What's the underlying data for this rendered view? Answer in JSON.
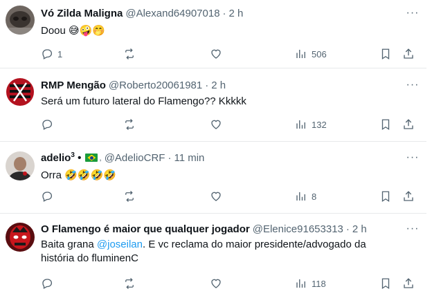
{
  "tweets": [
    {
      "name": "Vó Zilda Maligna",
      "handle": "@Alexand64907018",
      "time": "2 h",
      "text": "Doou 😅🤪🤭",
      "replies": "1",
      "views": "506"
    },
    {
      "name": "RMP Mengão",
      "handle": "@Roberto20061981",
      "time": "2 h",
      "text": "Será um futuro lateral do Flamengo?? Kkkkk",
      "views": "132"
    },
    {
      "name": "adelio",
      "name_sup": "3",
      "name_suffix": "•",
      "badge": "🇧🇷",
      "badge_comma": ",",
      "handle": "@AdelioCRF",
      "time": "11 min",
      "text": "Orra 🤣🤣🤣🤣",
      "views": "8"
    },
    {
      "name": "O Flamengo é maior que qualquer jogador",
      "handle": "@Elenice91653313",
      "time": "2 h",
      "text_before": "Baita grana ",
      "mention": "@joseilan",
      "text_after": ". E vc reclama do maior presidente/advogado da história do fluminenC",
      "views": "118"
    }
  ],
  "ui": {
    "dot": "·",
    "more": "···"
  },
  "colors": {
    "text": "#0f1419",
    "secondary": "#536471",
    "link": "#1d9bf0",
    "divider": "#e7e9ea"
  }
}
